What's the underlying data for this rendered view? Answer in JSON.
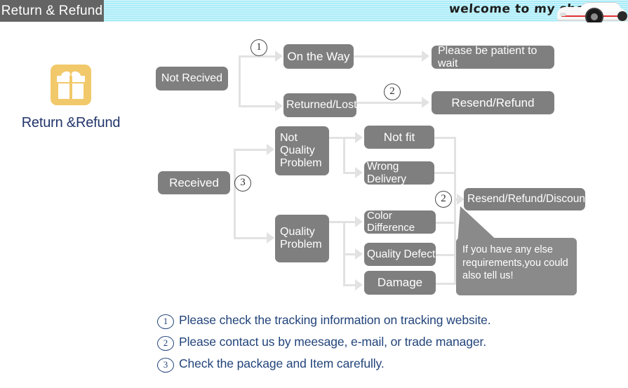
{
  "header": {
    "tab_label": "Return & Refund",
    "shop_welcome": "welcome to my shop",
    "banner_color": "#a9ecf8",
    "tab_color": "#646464"
  },
  "gift": {
    "label": "Return &Refund",
    "icon": "gift-icon",
    "icon_color": "#f2c96a",
    "label_color": "#22356b"
  },
  "flowchart": {
    "node_color": "#7f7f7f",
    "connector_color": "#e2e2e2",
    "nodes": {
      "not_recived": "Not Recived",
      "on_the_way": "On the Way",
      "returned_lost": "Returned/Lost",
      "please_wait": "Please be patient to wait",
      "resend_refund": "Resend/Refund",
      "received": "Received",
      "not_quality_problem": "Not\nQuality\nProblem",
      "not_quality_problem_l1": "Not",
      "not_quality_problem_l2": "Quality",
      "not_quality_problem_l3": "Problem",
      "quality_problem_l1": "Quality",
      "quality_problem_l2": "Problem",
      "not_fit": "Not fit",
      "wrong_delivery": "Wrong Delivery",
      "color_difference": "Color Difference",
      "quality_defect": "Quality Defect",
      "damage": "Damage",
      "resend_refund_discount": "Resend/Refund/Discount"
    },
    "markers": {
      "m1": "1",
      "m2_top": "2",
      "m3": "3",
      "m2_right": "2"
    },
    "bubble": "If you have any else requirements,you could also tell us!"
  },
  "notes": [
    {
      "num": "1",
      "text": "Please check the tracking information on tracking website."
    },
    {
      "num": "2",
      "text": "Please contact us by meesage, e-mail, or trade manager."
    },
    {
      "num": "3",
      "text": "Check the package and Item carefully."
    }
  ]
}
